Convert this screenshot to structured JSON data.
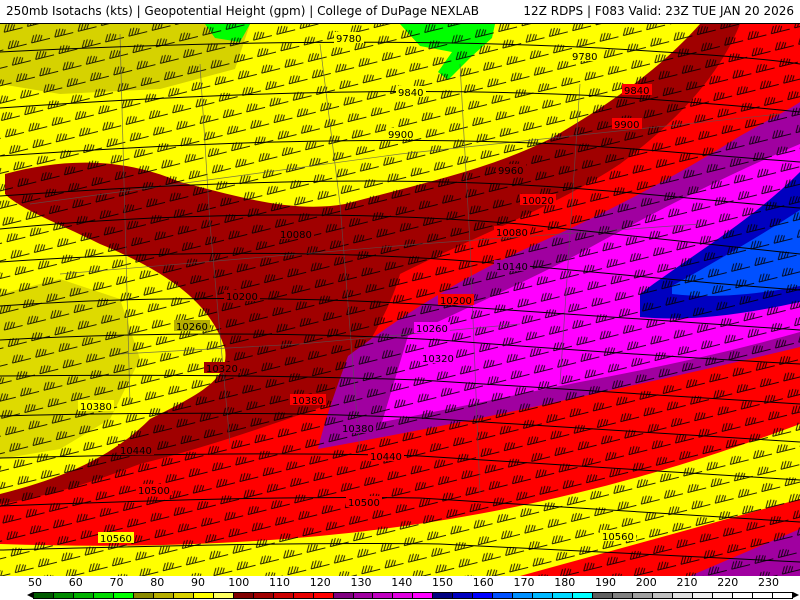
{
  "header": {
    "title_left": "250mb Isotachs (kts) | Geopotential Height (gpm) | College of DuPage NEXLAB",
    "title_right": "12Z RDPS | F083 Valid: 23Z TUE JAN 20 2026"
  },
  "map": {
    "height_contour_labels": [
      "9780",
      "9780",
      "9840",
      "9840",
      "9900",
      "9900",
      "9960",
      "10020",
      "10080",
      "10080",
      "10140",
      "10200",
      "10200",
      "10260",
      "10260",
      "10320",
      "10320",
      "10380",
      "10380",
      "10380",
      "10440",
      "10440",
      "10500",
      "10500",
      "10560",
      "10560"
    ],
    "region_colors": {
      "kt_60_70": "#008a00",
      "kt_80_90": "#00ff00",
      "kt_90_100": "#b5ad00",
      "kt_100_110": "#ffff00",
      "kt_110_120": "#a00000",
      "kt_120_130": "#cc0000",
      "kt_130_140": "#ff0000",
      "kt_140_150": "#a000a0",
      "kt_150_160": "#c000c0",
      "kt_160_170": "#ff00ff",
      "kt_170_180": "#0000c0",
      "kt_180_190": "#0050ff"
    }
  },
  "legend": {
    "labels": [
      "50",
      "60",
      "70",
      "80",
      "90",
      "100",
      "110",
      "120",
      "130",
      "140",
      "150",
      "160",
      "170",
      "180",
      "190",
      "200",
      "210",
      "220",
      "230"
    ],
    "colors": [
      "#005a00",
      "#008a00",
      "#00b000",
      "#00d800",
      "#00ff00",
      "#8a8a00",
      "#b5ad00",
      "#d8d000",
      "#ffff00",
      "#ffff60",
      "#800000",
      "#a00000",
      "#cc0000",
      "#e80000",
      "#ff0000",
      "#800080",
      "#a000a0",
      "#c000c0",
      "#e000e0",
      "#ff00ff",
      "#000080",
      "#0000c0",
      "#0000ff",
      "#0050ff",
      "#0090ff",
      "#00b8ff",
      "#00d8ff",
      "#00ffff",
      "#606060",
      "#808080",
      "#a0a0a0",
      "#c0c0c0",
      "#e0e0e0",
      "#f0f0f0",
      "#f8f8f8",
      "#ffffff",
      "#ffffff",
      "#ffffff"
    ]
  }
}
